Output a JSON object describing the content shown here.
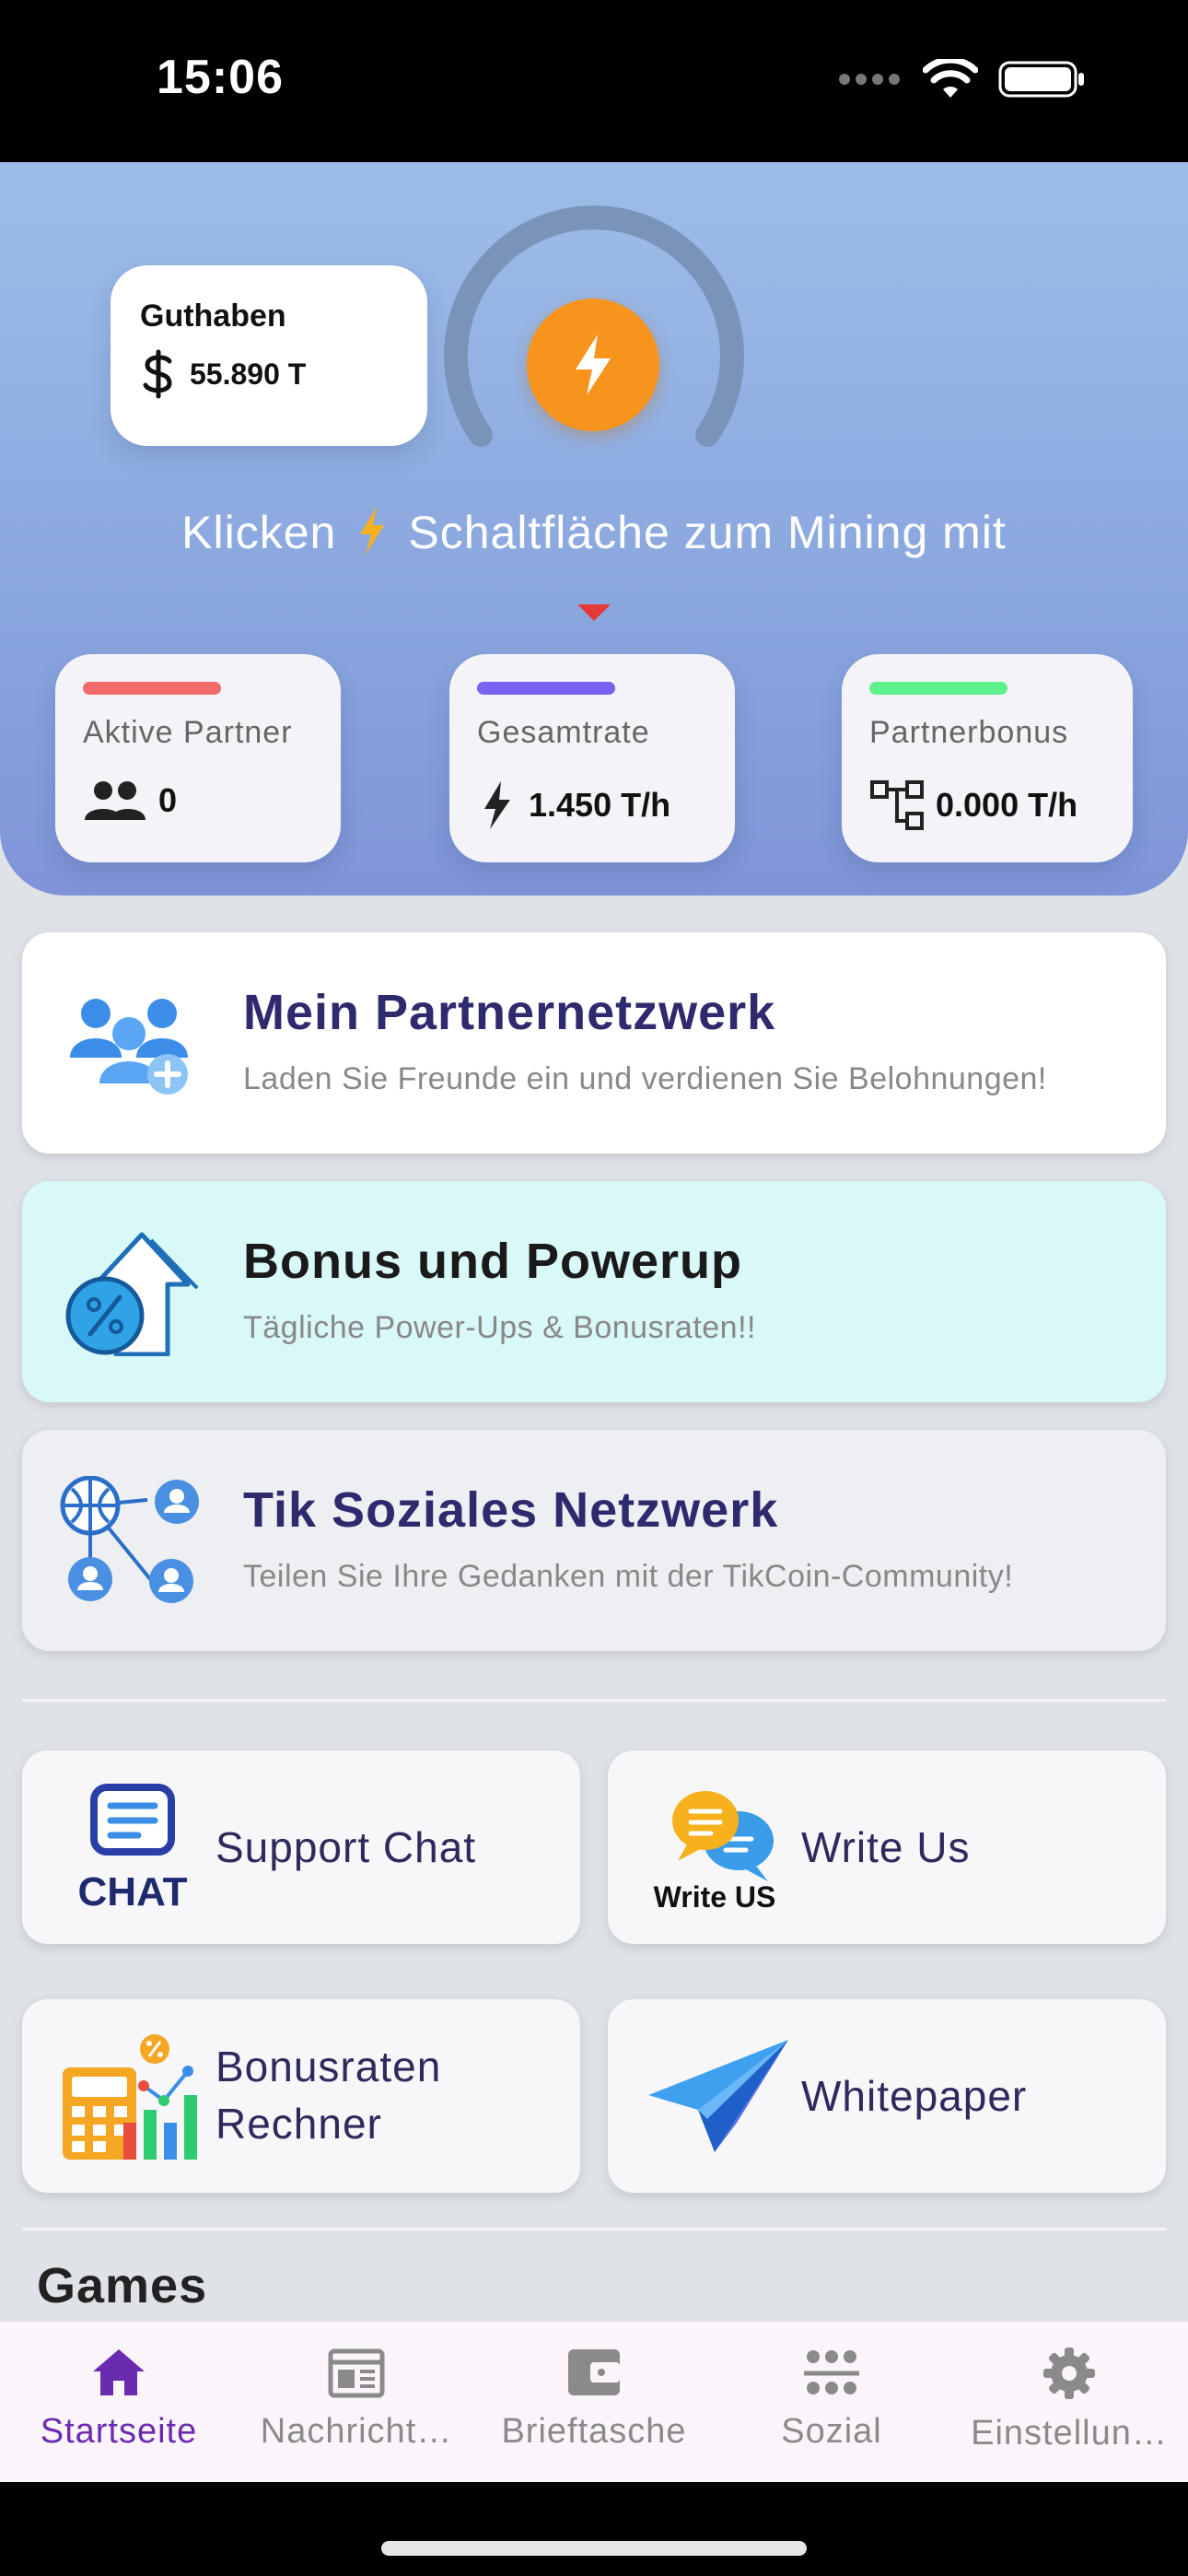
{
  "status_bar": {
    "time": "15:06"
  },
  "hero": {
    "balance": {
      "title": "Guthaben",
      "value": "55.890 T"
    },
    "rate": {
      "title": "Gesamtrate",
      "value": "1.450 T/h"
    },
    "hint_left": "Klicken",
    "hint_right": "Schaltfläche zum Mining mit",
    "stats": [
      {
        "label": "Aktive Partner",
        "value": "0",
        "color": "#f26b6b",
        "icon": "people-icon"
      },
      {
        "label": "Gesamtrate",
        "value": "1.450 T/h",
        "color": "#7b61f0",
        "icon": "bolt-icon"
      },
      {
        "label": "Partnerbonus",
        "value": "0.000 T/h",
        "color": "#5ef08d",
        "icon": "network-icon"
      }
    ]
  },
  "features": [
    {
      "title": "Mein Partnernetzwerk",
      "subtitle": "Laden Sie Freunde ein und verdienen Sie Belohnungen!",
      "bg": "#ffffff",
      "title_color": "#2d2a6e",
      "icon": "partner-network-icon"
    },
    {
      "title": "Bonus und Powerup",
      "subtitle": "Tägliche Power-Ups & Bonusraten!!",
      "bg": "#d9f8f8",
      "title_color": "#1a1a1a",
      "icon": "powerup-icon"
    },
    {
      "title": "Tik Soziales Netzwerk",
      "subtitle": "Teilen Sie Ihre Gedanken mit der TikCoin-Community!",
      "bg": "#eeeff2",
      "title_color": "#2d2a6e",
      "icon": "social-network-icon"
    }
  ],
  "tiles": {
    "support_chat": {
      "label": "Support Chat",
      "icon_text": "CHAT"
    },
    "write_us": {
      "label": "Write Us",
      "icon_text": "Write US"
    },
    "calculator": {
      "label_line1": "Bonusraten",
      "label_line2": "Rechner"
    },
    "whitepaper": {
      "label": "Whitepaper"
    }
  },
  "games_title": "Games",
  "nav": [
    {
      "label": "Startseite",
      "icon": "home-icon",
      "active": true
    },
    {
      "label": "Nachricht…",
      "icon": "news-icon",
      "active": false
    },
    {
      "label": "Brieftasche",
      "icon": "wallet-icon",
      "active": false
    },
    {
      "label": "Sozial",
      "icon": "social-icon",
      "active": false
    },
    {
      "label": "Einstellun…",
      "icon": "settings-icon",
      "active": false
    }
  ],
  "colors": {
    "accent": "#f7941d",
    "nav_active": "#6b2bb0",
    "title_navy": "#2d2a6e"
  }
}
